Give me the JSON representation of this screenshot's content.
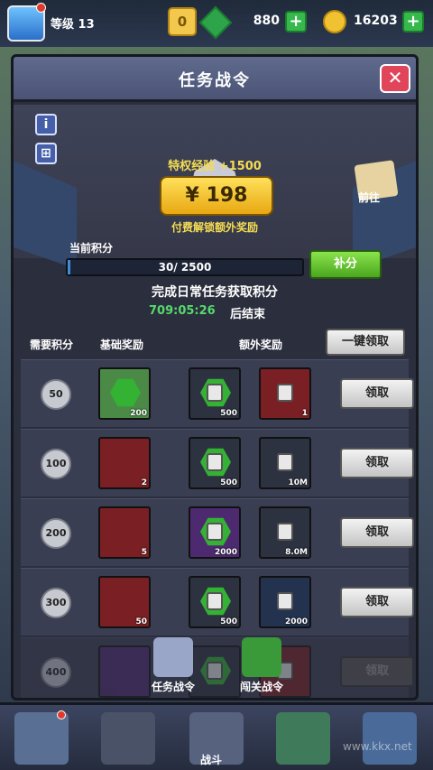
{
  "topbar": {
    "level_text": "等级 13",
    "crown_glyph": "0",
    "gem_currency": "880",
    "coin_currency": "16203",
    "plus_label": "+"
  },
  "panel": {
    "title": "任务战令",
    "close_label": "✕",
    "info_label": "i",
    "gift_label": "⊞",
    "xp_bonus": "特权经验 +1500",
    "price": "¥ 198",
    "unlock_text": "付费解锁额外奖励",
    "goto_label": "前往",
    "score_label": "当前积分",
    "score_progress": "30/ 2500",
    "score_fraction": 0.012,
    "supplement_label": "补分",
    "daily_text": "完成日常任务获取积分",
    "timer": "709:05:26",
    "end_text": "后结束",
    "col_points": "需要积分",
    "col_basic": "基础奖励",
    "col_extra": "额外奖励",
    "claim_all": "一键领取",
    "claim_label": "领取"
  },
  "rows": [
    {
      "points": "50",
      "basic_count": "200",
      "extra1_count": "500",
      "extra2_count": "1",
      "dim": false
    },
    {
      "points": "100",
      "basic_count": "2",
      "extra1_count": "500",
      "extra2_count": "10M",
      "dim": false
    },
    {
      "points": "200",
      "basic_count": "5",
      "extra1_count": "2000",
      "extra2_count": "8.0M",
      "dim": false
    },
    {
      "points": "300",
      "basic_count": "50",
      "extra1_count": "500",
      "extra2_count": "2000",
      "dim": false
    },
    {
      "points": "400",
      "basic_count": "",
      "extra1_count": "",
      "extra2_count": "",
      "dim": true
    }
  ],
  "tabs": [
    {
      "label": "任务战令"
    },
    {
      "label": "闯关战令"
    }
  ],
  "bottomnav": {
    "battle_label": "战斗",
    "watermark": "www.kkx.net"
  }
}
